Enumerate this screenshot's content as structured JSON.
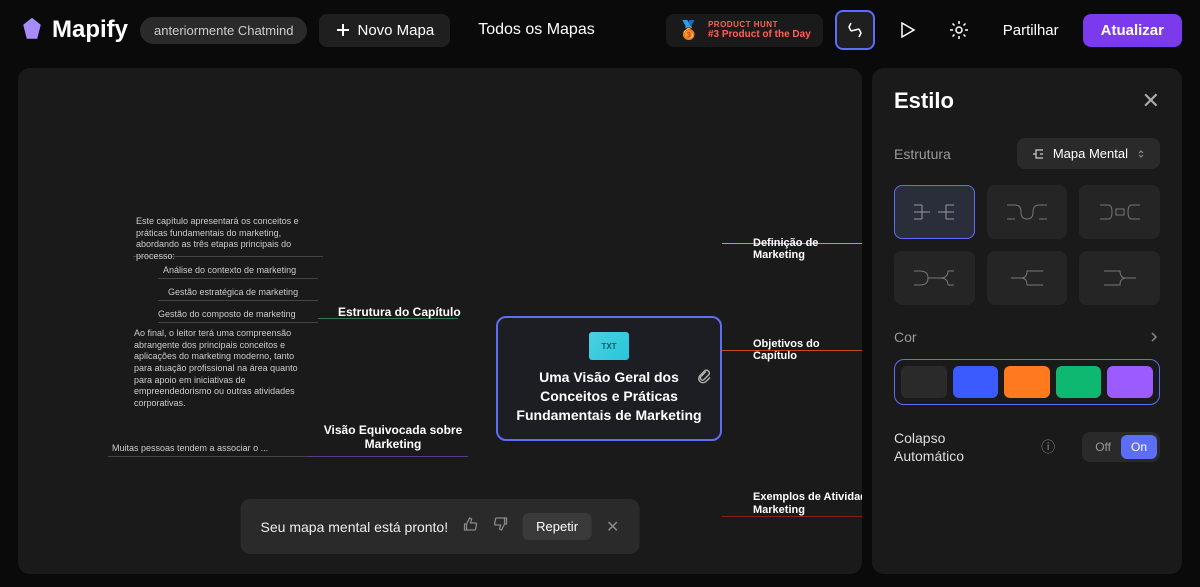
{
  "header": {
    "logo_text": "Mapify",
    "badge": "anteriormente Chatmind",
    "new_map": "Novo Mapa",
    "all_maps": "Todos os Mapas",
    "product_hunt": {
      "line1": "PRODUCT HUNT",
      "line2": "#3 Product of the Day"
    },
    "share": "Partilhar",
    "upgrade": "Atualizar"
  },
  "mindmap": {
    "center": "Uma Visão Geral dos Conceitos e Práticas Fundamentais de Marketing",
    "file_label": "TXT",
    "left_branches": {
      "estrutura": "Estrutura do Capítulo",
      "visao": "Visão Equivocada sobre Marketing"
    },
    "right_branches": {
      "definicao": "Definição de Marketing",
      "objetivos": "Objetivos do Capítulo",
      "exemplos": "Exemplos de Atividade Marketing"
    },
    "leaves": {
      "intro": "Este capítulo apresentará os conceitos e práticas fundamentais do marketing, abordando as três etapas principais do processo:",
      "analise": "Análise do contexto de marketing",
      "gestao_estrategica": "Gestão estratégica de marketing",
      "gestao_composto": "Gestão do composto de marketing",
      "final": "Ao final, o leitor terá uma compreensão abrangente dos principais conceitos e aplicações do marketing moderno, tanto para atuação profissional na área quanto para apoio em iniciativas de empreendedorismo ou outras atividades corporativas.",
      "muitas": "Muitas pessoas tendem a associar o ..."
    }
  },
  "panel": {
    "title": "Estilo",
    "structure_label": "Estrutura",
    "structure_value": "Mapa Mental",
    "color_label": "Cor",
    "colors": [
      "#2a2a2a",
      "#3b5bff",
      "#ff7a1f",
      "#0fb871",
      "#9b5bff"
    ],
    "collapse_label": "Colapso Automático",
    "toggle": {
      "off": "Off",
      "on": "On"
    }
  },
  "toast": {
    "text": "Seu mapa mental está pronto!",
    "repeat": "Repetir"
  }
}
